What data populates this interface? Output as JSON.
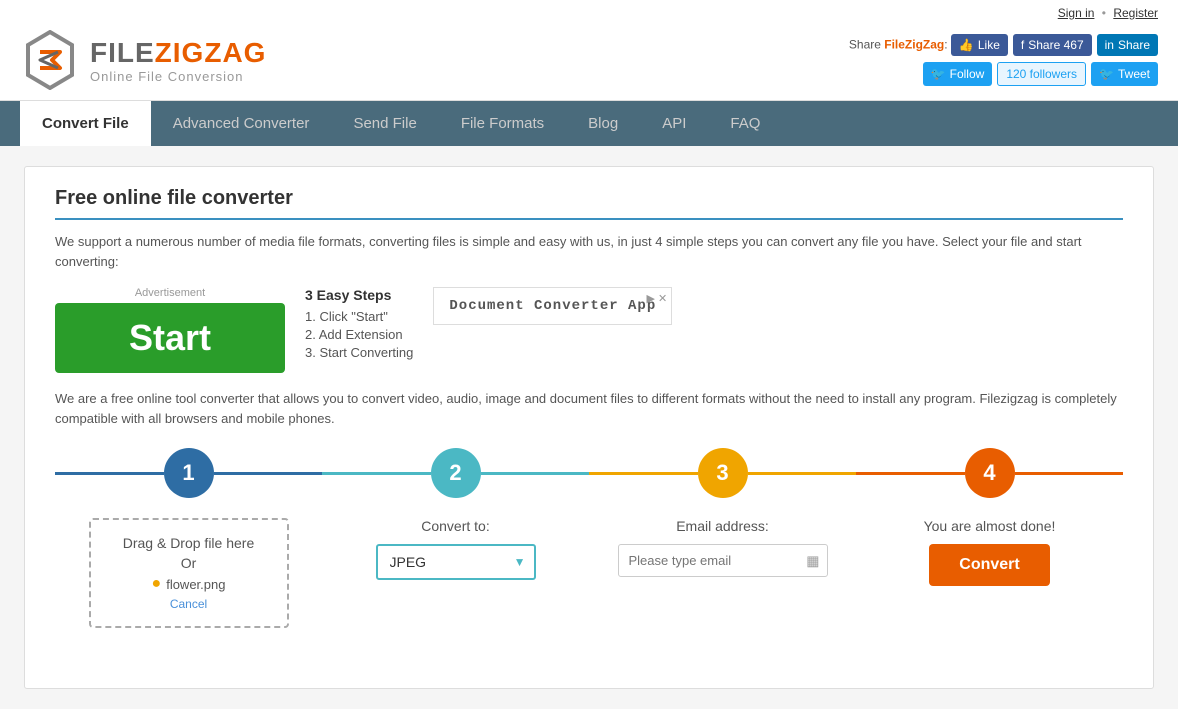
{
  "topLinks": {
    "signIn": "Sign in",
    "register": "Register",
    "separator": "•"
  },
  "logo": {
    "file": "FILE",
    "zigzag": "ZIGZAG",
    "subtitle": "Online File Conversion"
  },
  "social": {
    "shareLabel": "Share FileZigZag:",
    "shareLinkText": "FileZigZag",
    "likeLabel": "Like",
    "shareCount": "Share 467",
    "linkedinShare": "Share",
    "followLabel": "Follow",
    "followersCount": "120 followers",
    "tweetLabel": "Tweet"
  },
  "nav": {
    "items": [
      {
        "label": "Convert File",
        "active": true
      },
      {
        "label": "Advanced Converter",
        "active": false
      },
      {
        "label": "Send File",
        "active": false
      },
      {
        "label": "File Formats",
        "active": false
      },
      {
        "label": "Blog",
        "active": false
      },
      {
        "label": "API",
        "active": false
      },
      {
        "label": "FAQ",
        "active": false
      }
    ]
  },
  "pageTitle": "Free online file converter",
  "description": "We support a numerous number of media file formats, converting files is simple and easy with us, in just 4 simple steps you can convert any file you have. Select your file and start converting:",
  "ad": {
    "label": "Advertisement",
    "banner": "Start",
    "easySteps": {
      "title": "3 Easy Steps",
      "steps": [
        "1. Click \"Start\"",
        "2. Add Extension",
        "3. Start Converting"
      ]
    },
    "docConverter": "Document Converter App"
  },
  "desc2": "We are a free online tool converter that allows you to convert video, audio, image and document files to different formats without the need to install any program. Filezigzag is completely compatible with all browsers and mobile phones.",
  "steps": [
    {
      "number": "1",
      "dropLabel": "Drag & Drop file here",
      "orLabel": "Or",
      "fileName": "flower.png",
      "cancelLabel": "Cancel"
    },
    {
      "number": "2",
      "label": "Convert to:",
      "format": "JPEG"
    },
    {
      "number": "3",
      "label": "Email address:",
      "placeholder": "Please type email"
    },
    {
      "number": "4",
      "almostDone": "You are almost done!",
      "convertLabel": "Convert"
    }
  ]
}
